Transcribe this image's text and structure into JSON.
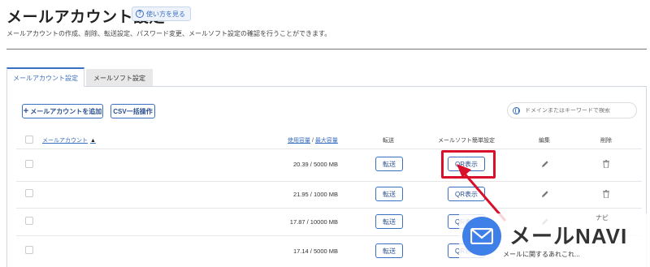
{
  "header": {
    "title": "メールアカウント設定",
    "help_label": "使い方を見る",
    "help_icon": "question-circle-icon",
    "description": "メールアカウントの作成、削除、転送設定、パスワード変更、メールソフト設定の確認を行うことができます。"
  },
  "tabs": [
    {
      "label": "メールアカウント設定",
      "active": true
    },
    {
      "label": "メールソフト設定",
      "active": false
    }
  ],
  "toolbar": {
    "add_label": "メールアカウントを追加",
    "csv_label": "CSV一括操作",
    "search_placeholder": "ドメインまたはキーワードで検索"
  },
  "table": {
    "headers": {
      "account": "メールアカウント",
      "sort_indicator": "▲",
      "usage": "使用容量",
      "usage_sep": "/",
      "capacity": "最大容量",
      "forward": "転送",
      "mail_setup": "メールソフト簡単設定",
      "edit": "編集",
      "delete": "削除"
    },
    "rows": [
      {
        "usage": "20.39 / 5000 MB",
        "forward_label": "転送",
        "qr_label": "QR表示"
      },
      {
        "usage": "21.95 / 1000 MB",
        "forward_label": "転送",
        "qr_label": "QR表示"
      },
      {
        "usage": "17.87 / 10000 MB",
        "forward_label": "転送",
        "qr_label": "QR表示"
      },
      {
        "usage": "17.14 / 5000 MB",
        "forward_label": "転送",
        "qr_label": "QR表示"
      }
    ]
  },
  "overlay": {
    "highlight_color": "#d8102a",
    "logo_text": "メールNAVI",
    "logo_ruby": "ナビ",
    "logo_tagline": "メールに関するあれこれ...",
    "logo_icon": "envelope-icon",
    "brand_color": "#3f7fe8"
  },
  "colors": {
    "accent": "#3a6fc1"
  }
}
